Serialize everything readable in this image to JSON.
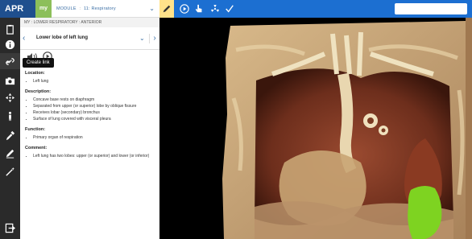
{
  "app": {
    "logo_text": "APR"
  },
  "module_bar": {
    "my_label": "my",
    "module_label": "MODULE",
    "module_name": "11: Respiratory"
  },
  "breadcrumb": "MY : LOWER RESPIRATORY : ANTERIOR",
  "structure": {
    "name": "Lower lobe of left lung"
  },
  "tooltip": {
    "text": "Create link"
  },
  "sections": {
    "location": {
      "title": "Location:",
      "items": [
        "Left lung"
      ]
    },
    "description": {
      "title": "Description:",
      "items": [
        "Concave base rests on diaphragm",
        "Separated from upper (or superior) lobe by oblique fissure",
        "Receives lobar (secondary) bronchus",
        "Surface of lung covered with visceral pleura"
      ]
    },
    "function": {
      "title": "Function:",
      "items": [
        "Primary organ of respiration"
      ]
    },
    "comment": {
      "title": "Comment:",
      "items": [
        "Left lung has two lobes: upper (or superior) and lower (or inferior)"
      ]
    }
  },
  "toolbar_icons": [
    "clipboard-icon",
    "info-icon",
    "link-icon",
    "camera-icon",
    "move-icon",
    "body-icon",
    "dropper-icon",
    "pencil-icon",
    "wand-icon",
    "exit-icon"
  ],
  "top_toolbar_icons": [
    "pen-icon",
    "play-icon",
    "hand-pointer-icon",
    "radiation-icon",
    "checkmark-icon"
  ],
  "search": {
    "placeholder": ""
  },
  "colors": {
    "toolbar_bg": "#2a2a2a",
    "topbar_blue": "#1c6fd1",
    "logo_blue": "#1f4f8e",
    "my_green": "#8cbf5a",
    "highlight_green": "#7ed321",
    "pen_yellow": "#ffe28a"
  }
}
